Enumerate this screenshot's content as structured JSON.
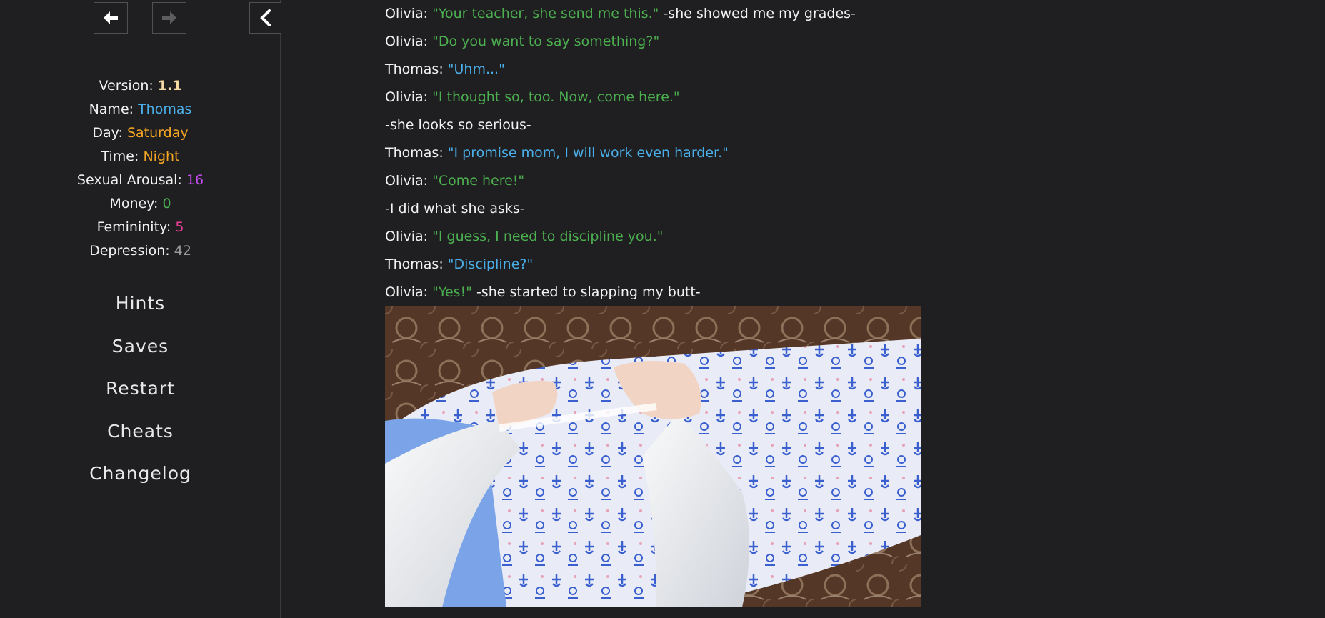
{
  "nav": {
    "back_icon": "arrow-left-icon",
    "forward_icon": "arrow-right-icon",
    "collapse_icon": "chevron-left-icon"
  },
  "stats": [
    {
      "label": "Version: ",
      "value": "1.1",
      "key": "version",
      "color": "#f3d9a4"
    },
    {
      "label": "Name: ",
      "value": "Thomas",
      "key": "name",
      "color": "#4aaee8"
    },
    {
      "label": "Day: ",
      "value": "Saturday",
      "key": "day",
      "color": "#f5a623"
    },
    {
      "label": "Time: ",
      "value": "Night",
      "key": "time",
      "color": "#f5a623"
    },
    {
      "label": "Sexual Arousal: ",
      "value": "16",
      "key": "arousal",
      "color": "#c04ef0"
    },
    {
      "label": "Money: ",
      "value": "0",
      "key": "money",
      "color": "#4caf50"
    },
    {
      "label": "Femininity: ",
      "value": "5",
      "key": "femininity",
      "color": "#f0409a"
    },
    {
      "label": "Depression: ",
      "value": "42",
      "key": "depression",
      "color": "#9a9a9a"
    }
  ],
  "menu": [
    {
      "label": "Hints",
      "key": "hints"
    },
    {
      "label": "Saves",
      "key": "saves"
    },
    {
      "label": "Restart",
      "key": "restart"
    },
    {
      "label": "Cheats",
      "key": "cheats"
    },
    {
      "label": "Changelog",
      "key": "changelog"
    }
  ],
  "passage": [
    {
      "speaker": "Olivia: ",
      "quote": "\"Your teacher, she send me this.\"",
      "style": "olivia",
      "narration": " -she showed me my grades-"
    },
    {
      "speaker": "Olivia: ",
      "quote": "\"Do you want to say something?\"",
      "style": "olivia",
      "narration": ""
    },
    {
      "speaker": "Thomas: ",
      "quote": "\"Uhm...\"",
      "style": "thomas",
      "narration": ""
    },
    {
      "speaker": "Olivia: ",
      "quote": "\"I thought so, too. Now, come here.\"",
      "style": "olivia",
      "narration": ""
    },
    {
      "speaker": "",
      "quote": "",
      "style": "narr",
      "narration": "-she looks so serious-"
    },
    {
      "speaker": "Thomas: ",
      "quote": "\"I promise mom, I will work even harder.\"",
      "style": "thomas",
      "narration": ""
    },
    {
      "speaker": "Olivia: ",
      "quote": "\"Come here!\"",
      "style": "olivia",
      "narration": ""
    },
    {
      "speaker": "",
      "quote": "",
      "style": "narr",
      "narration": "-I did what she asks-"
    },
    {
      "speaker": "Olivia: ",
      "quote": "\"I guess, I need to discipline you.\"",
      "style": "olivia",
      "narration": ""
    },
    {
      "speaker": "Thomas: ",
      "quote": "\"Discipline?\"",
      "style": "thomas",
      "narration": ""
    },
    {
      "speaker": "Olivia: ",
      "quote": "\"Yes!\"",
      "style": "olivia",
      "narration": " -she started to slapping my butt-"
    }
  ],
  "colors": {
    "background": "#1f1e20",
    "olivia_quote": "#4caf50",
    "thomas_quote": "#4aaee8",
    "text": "#f2f2f2"
  }
}
